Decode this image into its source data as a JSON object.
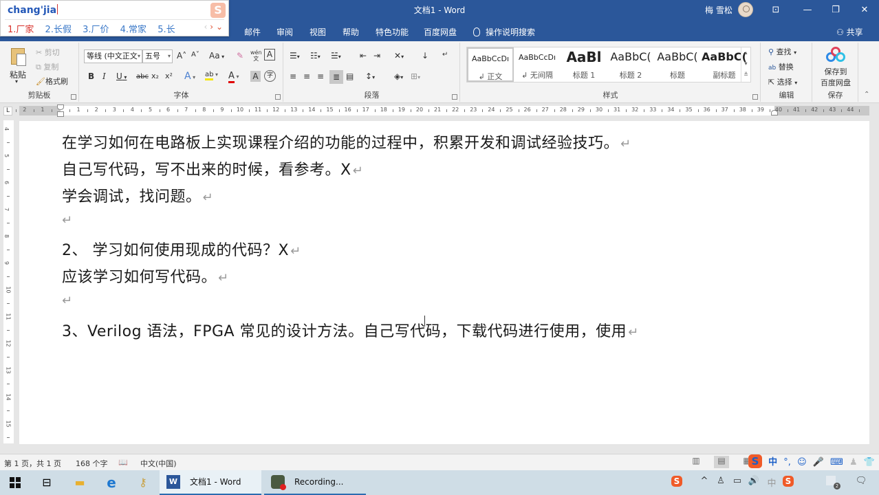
{
  "window": {
    "title": "文档1  -  Word",
    "user_name": "梅 雪松",
    "controls": {
      "ribbon_display": "⊡",
      "minimize": "—",
      "restore": "❐",
      "close": "✕"
    }
  },
  "tabs": {
    "items": [
      "邮件",
      "审阅",
      "视图",
      "帮助",
      "特色功能",
      "百度网盘"
    ],
    "tell_me": "操作说明搜索",
    "share": "共享"
  },
  "ime_popup": {
    "input": "chang'jia",
    "candidates": [
      "1.厂家",
      "2.长假",
      "3.厂价",
      "4.常家",
      "5.长"
    ],
    "nav_prev": "‹",
    "nav_next": "›",
    "expand": "⌄",
    "logo": "S"
  },
  "ribbon": {
    "clipboard": {
      "label": "剪贴板",
      "paste": "粘贴",
      "cut": "剪切",
      "copy": "复制",
      "format_painter": "格式刷"
    },
    "font": {
      "label": "字体",
      "font_name": "等线 (中文正文",
      "font_size": "五号",
      "grow": "A˄",
      "shrink": "A˅",
      "change_case": "Aa",
      "clear_format": "✎",
      "phonetic": "wén",
      "char_border": "A",
      "bold": "B",
      "italic": "I",
      "underline": "U",
      "strikethrough": "abc",
      "subscript": "x₂",
      "superscript": "x²",
      "text_effects": "A",
      "highlight": "ab",
      "font_color": "A",
      "char_shading": "A",
      "enclose": "字",
      "highlight_color": "#f5e600",
      "font_color_value": "#e00000"
    },
    "paragraph": {
      "label": "段落"
    },
    "styles": {
      "label": "样式",
      "items": [
        {
          "sample": "AaBbCcDı",
          "name": "↲ 正文"
        },
        {
          "sample": "AaBbCcDı",
          "name": "↲ 无间隔"
        },
        {
          "sample": "AaBl",
          "name": "标题 1"
        },
        {
          "sample": "AaBbC(",
          "name": "标题 2"
        },
        {
          "sample": "AaBbC(",
          "name": "标题"
        },
        {
          "sample": "AaBbC(",
          "name": "副标题"
        }
      ]
    },
    "editing": {
      "label": "编辑",
      "find": "查找",
      "replace": "替换",
      "select": "选择"
    },
    "save": {
      "label": "保存",
      "button_line1": "保存到",
      "button_line2": "百度网盘"
    }
  },
  "ruler": {
    "corner": "L",
    "left_margin_numbers": [
      "2",
      "1"
    ],
    "numbers": [
      "1",
      "2",
      "3",
      "4",
      "5",
      "6",
      "7",
      "8",
      "9",
      "10",
      "11",
      "12",
      "13",
      "14",
      "15",
      "16",
      "17",
      "18",
      "19",
      "20",
      "21",
      "22",
      "23",
      "24",
      "25",
      "26",
      "27",
      "28",
      "29",
      "30",
      "31",
      "32",
      "33",
      "34",
      "35",
      "36",
      "37",
      "38",
      "39",
      "40",
      "41",
      "42",
      "43",
      "44"
    ],
    "vertical_numbers": [
      "4",
      "5",
      "6",
      "7",
      "8",
      "9",
      "10",
      "11",
      "12",
      "13",
      "14",
      "15"
    ]
  },
  "document": {
    "paragraphs": [
      "在学习如何在电路板上实现课程介绍的功能的过程中，积累开发和调试经验技巧。",
      "自己写代码，写不出来的时候，看参考。X",
      "学会调试，找问题。",
      "",
      "2、 学习如何使用现成的代码？X",
      "应该学习如何写代码。",
      "",
      "3、Verilog 语法，FPGA 常见的设计方法。自己写代码，下载代码进行使用，使用"
    ],
    "paragraph_mark": "↵"
  },
  "status_bar": {
    "page": "第 1 页，共 1 页",
    "word_count": "168 个字",
    "language": "中文(中国)",
    "ime_mode": "中",
    "ime_punct": "°,"
  },
  "taskbar": {
    "apps": [
      {
        "label": "文档1 - Word",
        "active": true
      },
      {
        "label": "Recording...",
        "active": false
      }
    ],
    "tray_ime": "中",
    "tray_notification_badge": "2"
  }
}
